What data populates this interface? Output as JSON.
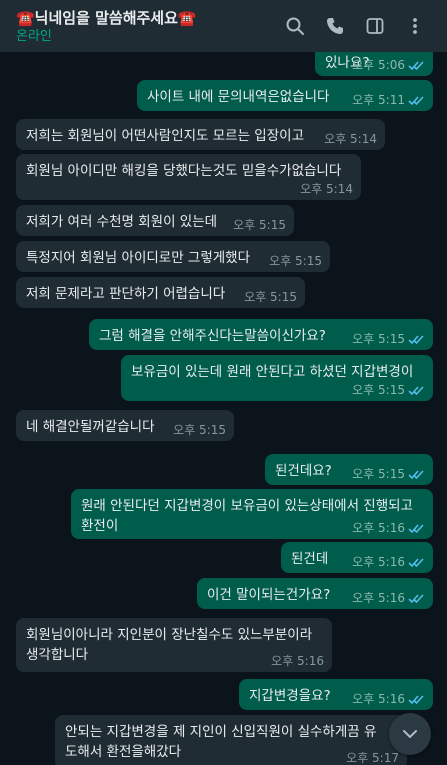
{
  "header": {
    "title": "☎️닉네임을 말씀해주세요☎️",
    "status": "온라인",
    "icons": [
      "search-icon",
      "phone-icon",
      "sidebar-panel-icon",
      "more-vertical-icon"
    ]
  },
  "messages": [
    {
      "dir": "out",
      "text": "있나요?",
      "time": "오후 5:06",
      "read": true
    },
    {
      "dir": "out",
      "text": "사이트 내에 문의내역은없습니다",
      "time": "오후 5:11",
      "read": true
    },
    {
      "dir": "in",
      "text": "저희는 회원님이 어떤사람인지도 모르는 입장이고",
      "time": "오후 5:14"
    },
    {
      "dir": "in",
      "text": "회원님 아이디만 해킹을 당했다는것도 믿을수가없습니다",
      "time": "오후 5:14"
    },
    {
      "dir": "in",
      "text": "저희가 여러 수천명 회원이 있는데",
      "time": "오후 5:15"
    },
    {
      "dir": "in",
      "text": "특정지어 회원님 아이디로만 그렇게했다",
      "time": "오후 5:15"
    },
    {
      "dir": "in",
      "text": "저희 문제라고 판단하기 어렵습니다",
      "time": "오후 5:15"
    },
    {
      "dir": "out",
      "text": "그럼 해결을 안해주신다는말씀이신가요?",
      "time": "오후 5:15",
      "read": true
    },
    {
      "dir": "out",
      "text": "보유금이 있는데 원래 안된다고 하셨던 지갑변경이",
      "time": "오후 5:15",
      "read": true
    },
    {
      "dir": "in",
      "text": "네 해결안될꺼같습니다",
      "time": "오후 5:15"
    },
    {
      "dir": "out",
      "text": "된건데요?",
      "time": "오후 5:15",
      "read": true
    },
    {
      "dir": "out",
      "text": "원래 안된다던 지갑변경이 보유금이 있는상태에서 진행되고 환전이",
      "time": "오후 5:16",
      "read": true
    },
    {
      "dir": "out",
      "text": "된건데",
      "time": "오후 5:16",
      "read": true
    },
    {
      "dir": "out",
      "text": "이건 말이되는건가요?",
      "time": "오후 5:16",
      "read": true
    },
    {
      "dir": "in",
      "text": "회원님이아니라 지인분이 장난칠수도 있느부분이라 생각합니다",
      "time": "오후 5:16"
    },
    {
      "dir": "out",
      "text": "지갑변경을요?",
      "time": "오후 5:16",
      "read": true
    },
    {
      "dir": "in",
      "text": "안되는 지갑변경을 제 지인이 신입직원이 실수하게끔 유도해서 환전을해갔다",
      "time": "오후 5:17"
    }
  ],
  "scroll_button": {
    "icon": "chevron-down-icon"
  }
}
